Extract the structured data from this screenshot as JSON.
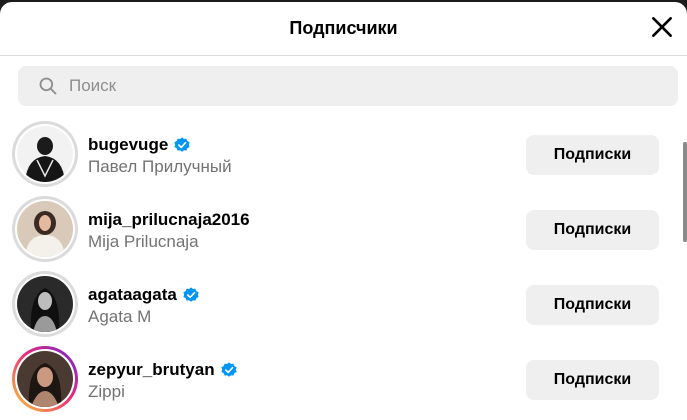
{
  "header": {
    "title": "Подписчики",
    "close_icon": "close-icon"
  },
  "search": {
    "placeholder": "Поиск",
    "value": "",
    "icon": "search-icon"
  },
  "users": [
    {
      "username": "bugevuge",
      "full_name": "Павел Прилучный",
      "verified": true,
      "story_ring": false,
      "button_label": "Подписки"
    },
    {
      "username": "mija_prilucnaja2016",
      "full_name": "Mija Prilucnaja",
      "verified": false,
      "story_ring": false,
      "button_label": "Подписки"
    },
    {
      "username": "agataagata",
      "full_name": "Agata M",
      "verified": true,
      "story_ring": false,
      "button_label": "Подписки"
    },
    {
      "username": "zepyur_brutyan",
      "full_name": "Zippi",
      "verified": true,
      "story_ring": true,
      "button_label": "Подписки"
    }
  ],
  "colors": {
    "verified_badge": "#0095f6",
    "button_bg": "#efefef",
    "secondary_text": "#737373"
  }
}
